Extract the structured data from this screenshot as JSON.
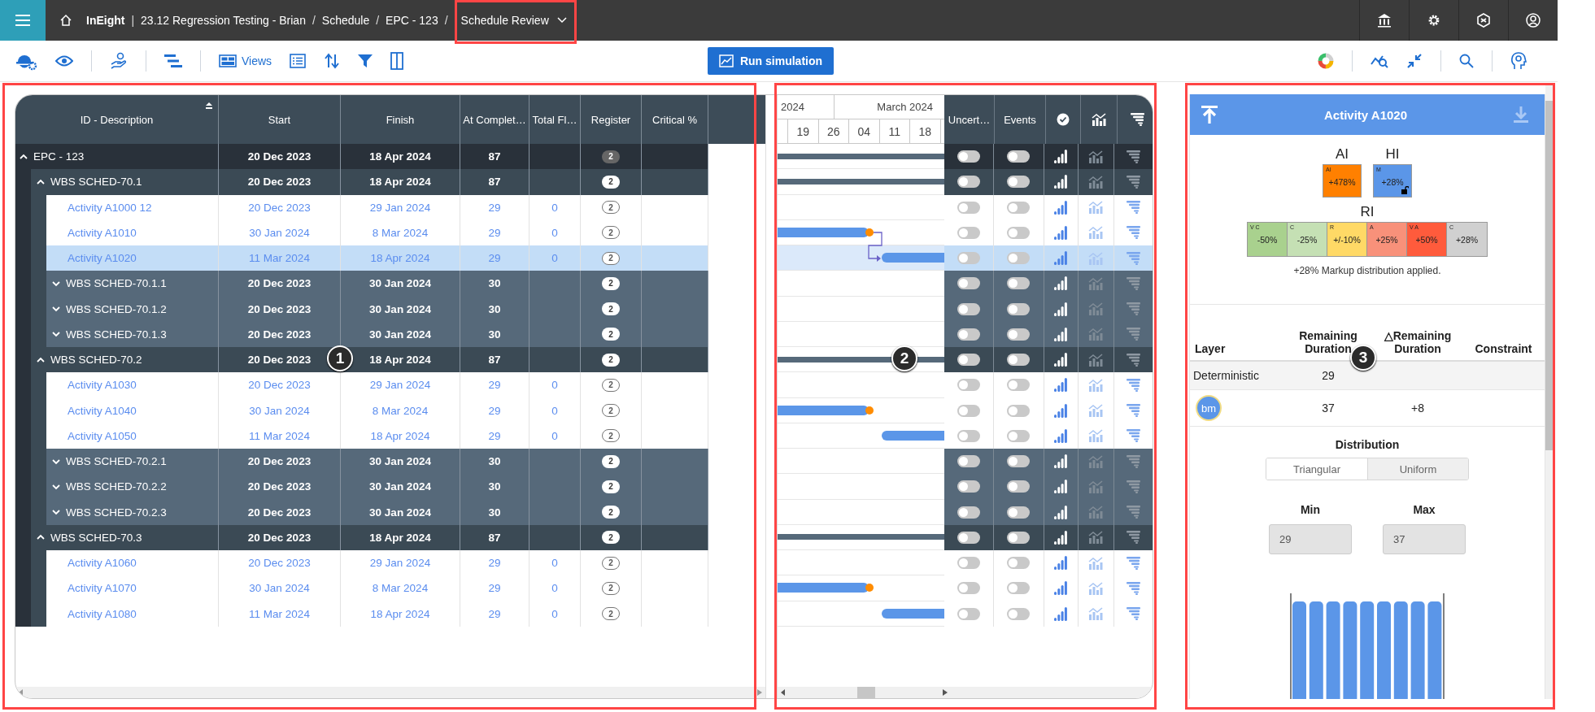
{
  "topbar": {
    "brand": "InEight",
    "brand_separator": "|",
    "separator": "/",
    "breadcrumbs": [
      {
        "label": "23.12 Regression Testing - Brian",
        "dropdown": false
      },
      {
        "label": "Schedule",
        "dropdown": false
      },
      {
        "label": "EPC - 123",
        "dropdown": false
      },
      {
        "label": "Schedule Review",
        "dropdown": true
      }
    ]
  },
  "toolbar": {
    "views_label": "Views",
    "run_button": "Run simulation"
  },
  "grid": {
    "columns": [
      {
        "label": "ID - Description",
        "sorted": true
      },
      {
        "label": "Start",
        "sorted": false
      },
      {
        "label": "Finish",
        "sorted": false
      },
      {
        "label": "At Complet…",
        "sorted": false
      },
      {
        "label": "Total Fl…",
        "sorted": false
      },
      {
        "label": "Register",
        "sorted": false
      },
      {
        "label": "Critical %",
        "sorted": false
      }
    ],
    "rows": [
      {
        "kind": "project",
        "label": "EPC - 123",
        "start": "20 Dec 2023",
        "finish": "18 Apr 2024",
        "at_completion": "87",
        "register": "2",
        "expanded": true,
        "selected": false,
        "uncertainty": false,
        "events": false,
        "gantt_bar": {
          "kind": "summary"
        },
        "children": [
          {
            "kind": "wbs",
            "label": "WBS SCHED-70.1",
            "start": "20 Dec 2023",
            "finish": "18 Apr 2024",
            "at_completion": "87",
            "register": "2",
            "expanded": true,
            "selected": false,
            "uncertainty": false,
            "events": false,
            "gantt_bar": {
              "kind": "summary"
            },
            "children": [
              {
                "kind": "activity",
                "label": "Activity A1000 12",
                "start": "20 Dec 2023",
                "finish": "29 Jan 2024",
                "at_completion": "29",
                "total_float": "0",
                "register": "2",
                "selected": false,
                "uncertainty": false,
                "events": false,
                "link_in": false
              },
              {
                "kind": "activity",
                "label": "Activity A1010",
                "start": "30 Jan 2024",
                "finish": "8 Mar 2024",
                "at_completion": "29",
                "total_float": "0",
                "register": "2",
                "selected": false,
                "uncertainty": false,
                "events": false,
                "gantt_bar": {
                  "kind": "end"
                },
                "link_in": false
              },
              {
                "kind": "activity",
                "label": "Activity A1020",
                "start": "11 Mar 2024",
                "finish": "18 Apr 2024",
                "at_completion": "29",
                "total_float": "0",
                "register": "2",
                "selected": true,
                "uncertainty": false,
                "events": false,
                "gantt_bar": {
                  "kind": "start"
                },
                "link_in": true
              },
              {
                "kind": "sub",
                "label": "WBS SCHED-70.1.1",
                "start": "20 Dec 2023",
                "finish": "30 Jan 2024",
                "at_completion": "30",
                "register": "2",
                "expanded": false,
                "selected": false,
                "uncertainty": false,
                "events": false
              },
              {
                "kind": "sub",
                "label": "WBS SCHED-70.1.2",
                "start": "20 Dec 2023",
                "finish": "30 Jan 2024",
                "at_completion": "30",
                "register": "2",
                "expanded": false,
                "selected": false,
                "uncertainty": false,
                "events": false
              },
              {
                "kind": "sub",
                "label": "WBS SCHED-70.1.3",
                "start": "20 Dec 2023",
                "finish": "30 Jan 2024",
                "at_completion": "30",
                "register": "2",
                "expanded": false,
                "selected": false,
                "uncertainty": false,
                "events": false
              }
            ]
          },
          {
            "kind": "wbs",
            "label": "WBS SCHED-70.2",
            "start": "20 Dec 2023",
            "finish": "18 Apr 2024",
            "at_completion": "87",
            "register": "2",
            "expanded": true,
            "selected": false,
            "uncertainty": false,
            "events": false,
            "gantt_bar": {
              "kind": "summary"
            },
            "children": [
              {
                "kind": "activity",
                "label": "Activity A1030",
                "start": "20 Dec 2023",
                "finish": "29 Jan 2024",
                "at_completion": "29",
                "total_float": "0",
                "register": "2",
                "selected": false,
                "uncertainty": false,
                "events": false,
                "link_in": false
              },
              {
                "kind": "activity",
                "label": "Activity A1040",
                "start": "30 Jan 2024",
                "finish": "8 Mar 2024",
                "at_completion": "29",
                "total_float": "0",
                "register": "2",
                "selected": false,
                "uncertainty": false,
                "events": false,
                "gantt_bar": {
                  "kind": "end"
                },
                "link_in": false
              },
              {
                "kind": "activity",
                "label": "Activity A1050",
                "start": "11 Mar 2024",
                "finish": "18 Apr 2024",
                "at_completion": "29",
                "total_float": "0",
                "register": "2",
                "selected": false,
                "uncertainty": false,
                "events": false,
                "gantt_bar": {
                  "kind": "start"
                },
                "link_in": false
              },
              {
                "kind": "sub",
                "label": "WBS SCHED-70.2.1",
                "start": "20 Dec 2023",
                "finish": "30 Jan 2024",
                "at_completion": "30",
                "register": "2",
                "expanded": false,
                "selected": false,
                "uncertainty": false,
                "events": false
              },
              {
                "kind": "sub",
                "label": "WBS SCHED-70.2.2",
                "start": "20 Dec 2023",
                "finish": "30 Jan 2024",
                "at_completion": "30",
                "register": "2",
                "expanded": false,
                "selected": false,
                "uncertainty": false,
                "events": false
              },
              {
                "kind": "sub",
                "label": "WBS SCHED-70.2.3",
                "start": "20 Dec 2023",
                "finish": "30 Jan 2024",
                "at_completion": "30",
                "register": "2",
                "expanded": false,
                "selected": false,
                "uncertainty": false,
                "events": false
              }
            ]
          },
          {
            "kind": "wbs",
            "label": "WBS SCHED-70.3",
            "start": "20 Dec 2023",
            "finish": "18 Apr 2024",
            "at_completion": "87",
            "register": "2",
            "expanded": true,
            "selected": false,
            "uncertainty": false,
            "events": false,
            "gantt_bar": {
              "kind": "summary"
            },
            "children": [
              {
                "kind": "activity",
                "label": "Activity A1060",
                "start": "20 Dec 2023",
                "finish": "29 Jan 2024",
                "at_completion": "29",
                "total_float": "0",
                "register": "2",
                "selected": false,
                "uncertainty": false,
                "events": false,
                "link_in": false
              },
              {
                "kind": "activity",
                "label": "Activity A1070",
                "start": "30 Jan 2024",
                "finish": "8 Mar 2024",
                "at_completion": "29",
                "total_float": "0",
                "register": "2",
                "selected": false,
                "uncertainty": false,
                "events": false,
                "gantt_bar": {
                  "kind": "end"
                },
                "link_in": false
              },
              {
                "kind": "activity",
                "label": "Activity A1080",
                "start": "11 Mar 2024",
                "finish": "18 Apr 2024",
                "at_completion": "29",
                "total_float": "0",
                "register": "2",
                "selected": false,
                "uncertainty": false,
                "events": false,
                "gantt_bar": {
                  "kind": "start"
                },
                "link_in": false
              }
            ]
          }
        ]
      }
    ]
  },
  "gantt": {
    "months": [
      "2024",
      "March 2024"
    ],
    "weeks": [
      "19",
      "26",
      "04",
      "11",
      "18"
    ],
    "columns": [
      "Uncert…",
      "Events"
    ]
  },
  "detail": {
    "title": "Activity A1020",
    "ai_label": "AI",
    "hi_label": "HI",
    "ri_label": "RI",
    "ai": {
      "tag": "AI",
      "value": "+478%",
      "color": "#ff8000"
    },
    "hi": {
      "tag": "M",
      "value": "+28%",
      "color": "#5b96e8"
    },
    "ri": [
      {
        "tag": "V C",
        "value": "-50%",
        "color": "#a9d18e"
      },
      {
        "tag": "C",
        "value": "-25%",
        "color": "#c5e0b4"
      },
      {
        "tag": "R",
        "value": "+/-10%",
        "color": "#ffd966"
      },
      {
        "tag": "A",
        "value": "+25%",
        "color": "#f8917a"
      },
      {
        "tag": "V A",
        "value": "+50%",
        "color": "#ff5b3c"
      },
      {
        "tag": "C",
        "value": "+28%",
        "color": "#d0d0d0"
      }
    ],
    "note": "+28% Markup distribution applied.",
    "layer_columns": [
      "Layer",
      "Remaining Duration",
      "△Remaining Duration",
      "Constraint"
    ],
    "layers": [
      {
        "kind": "text",
        "layer": "Deterministic",
        "remaining": "29"
      },
      {
        "kind": "avatar",
        "layer": "bm",
        "remaining": "37",
        "delta": "+8"
      }
    ],
    "distribution": {
      "label": "Distribution",
      "options": [
        {
          "label": "Triangular",
          "selected": false
        },
        {
          "label": "Uniform",
          "selected": true
        }
      ]
    },
    "min": {
      "label": "Min",
      "value": "29",
      "disabled": true
    },
    "max": {
      "label": "Max",
      "value": "37",
      "disabled": true
    }
  },
  "annotations": [
    {
      "label": "1"
    },
    {
      "label": "2"
    },
    {
      "label": "3"
    }
  ]
}
